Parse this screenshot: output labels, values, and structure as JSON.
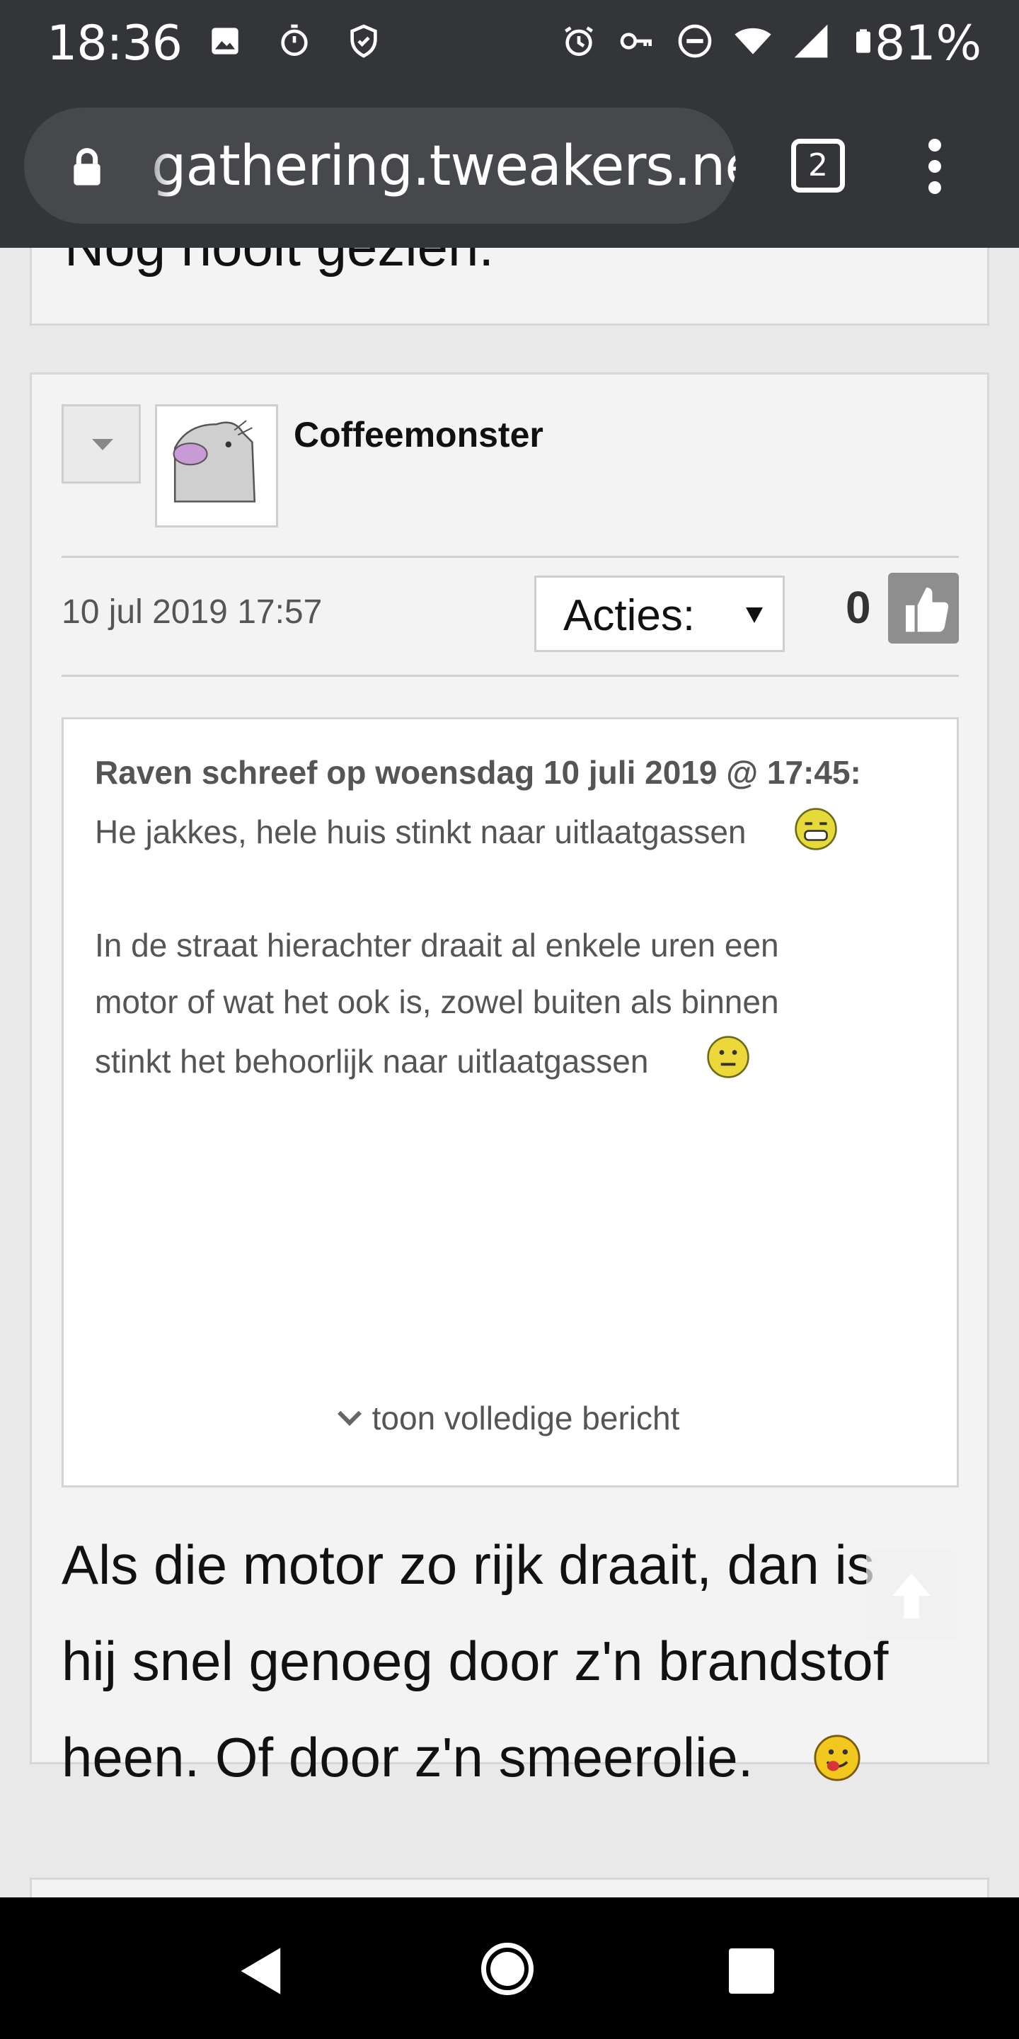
{
  "status_bar": {
    "time": "18:36",
    "battery": "81%",
    "icons_left": [
      "image-icon",
      "stopwatch-icon",
      "shield-icon"
    ],
    "icons_right": [
      "alarm-icon",
      "key-icon",
      "dnd-icon",
      "wifi-icon",
      "signal-icon",
      "battery-icon"
    ]
  },
  "browser": {
    "url": "gathering.tweakers.net",
    "tab_count": "2"
  },
  "previous_post": {
    "text_fragment": "Nog nooit gezien."
  },
  "post": {
    "username": "Coffeemonster",
    "date": "10 jul 2019 17:57",
    "actions_label": "Acties:",
    "likes": "0",
    "quote": {
      "author_line": "Raven schreef op woensdag 10 juli 2019 @ 17:45:",
      "lines": [
        "He jakkes, hele huis stinkt naar uitlaatgassen",
        "In de straat hierachter draait al enkele uren een",
        "motor of wat het ook is, zowel buiten als binnen",
        "stinkt het behoorlijk naar uitlaatgassen"
      ],
      "show_more": "toon volledige bericht"
    },
    "body_lines": [
      "Als die motor zo rijk draait, dan is",
      "hij snel genoeg door z'n brandstof",
      "heen. Of door z'n smeerolie."
    ]
  },
  "colors": {
    "chrome_bg": "#333538",
    "url_pill": "#46484c",
    "page_bg": "#e9e9e9",
    "post_bg": "#f3f3f3",
    "like_button": "#8e8e8e"
  }
}
